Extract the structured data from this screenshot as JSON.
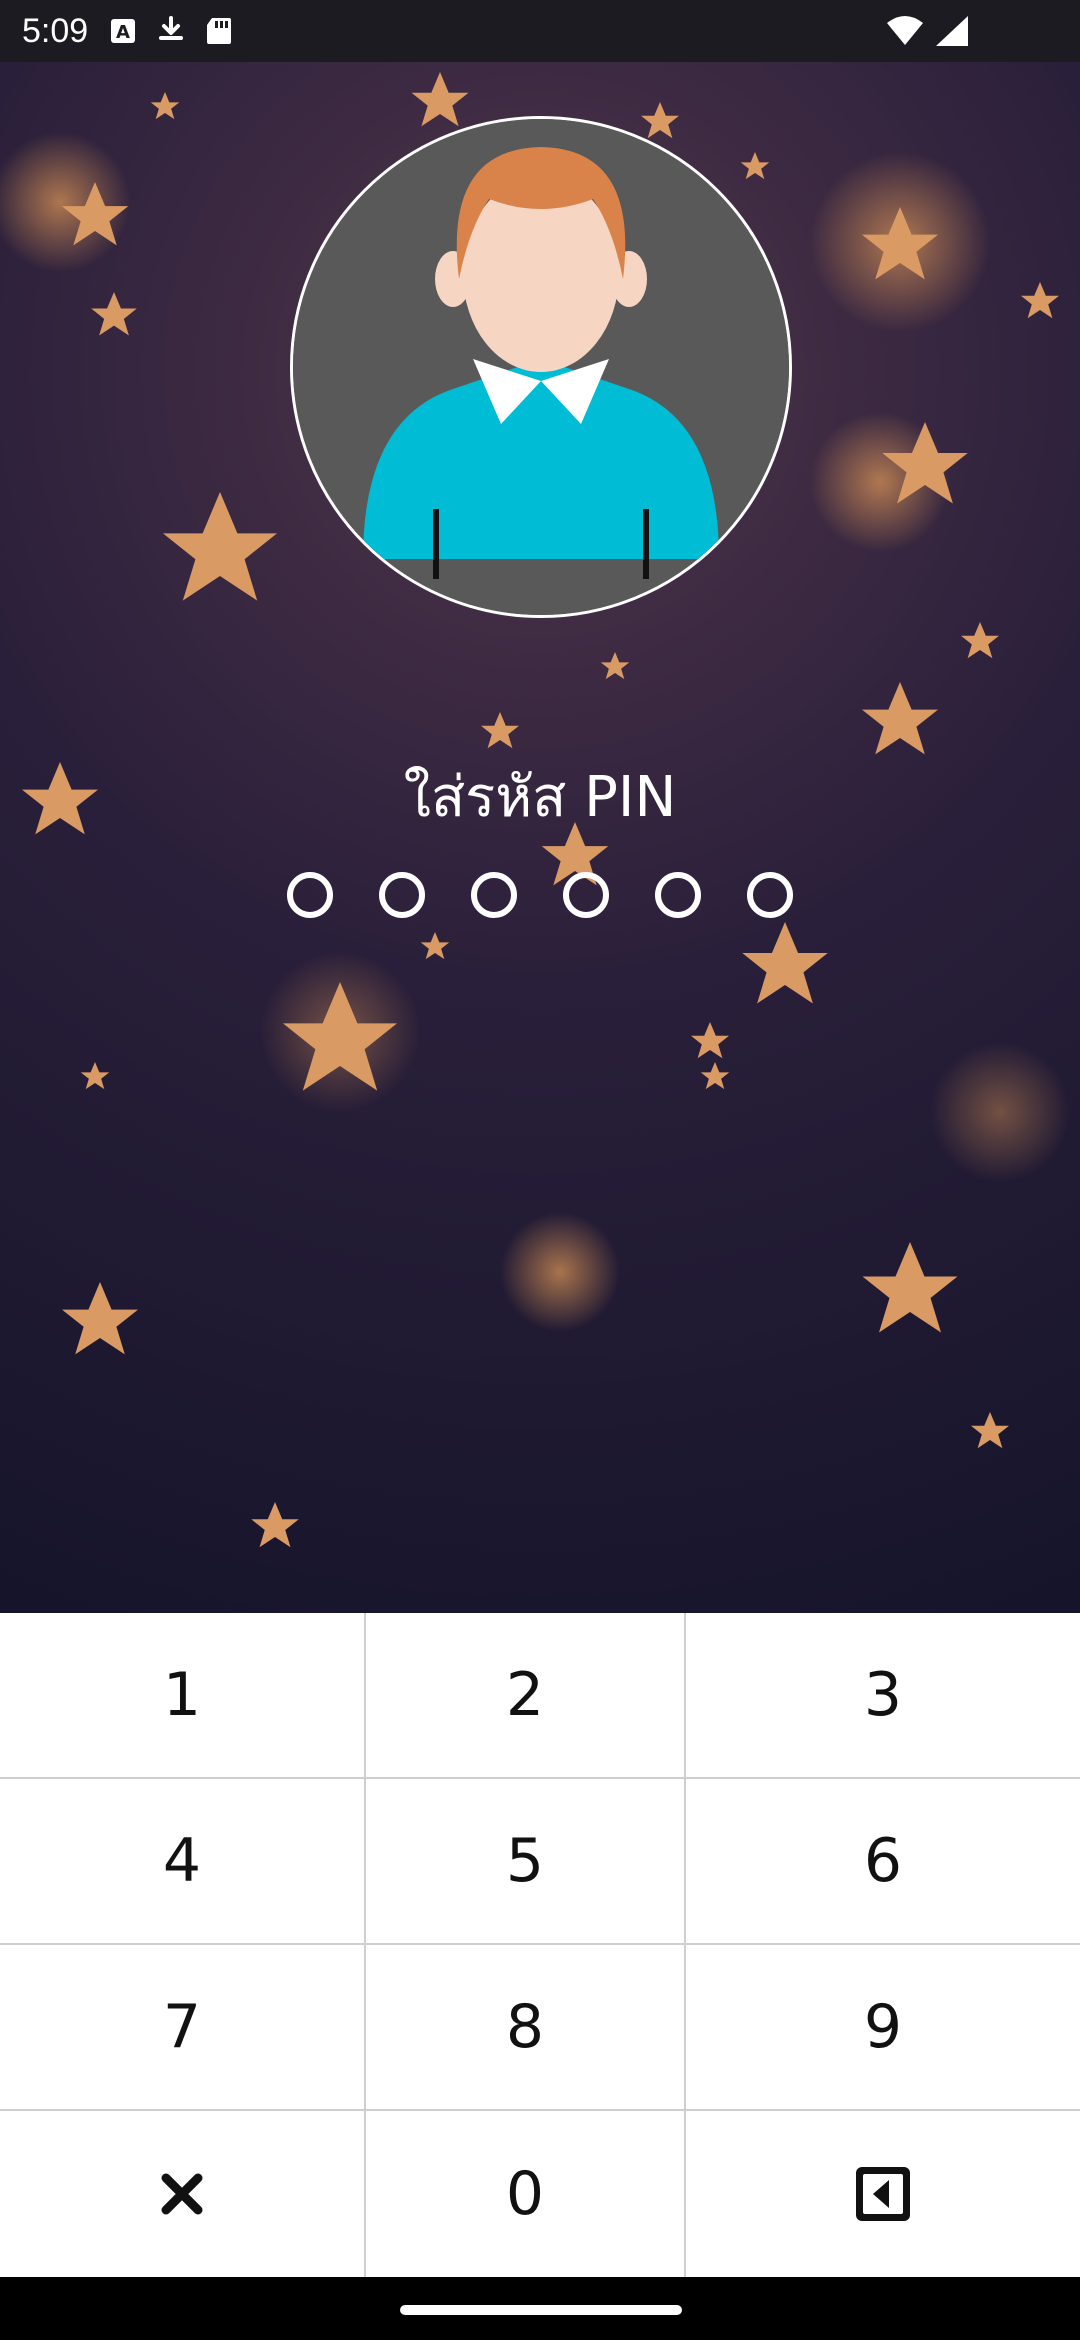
{
  "status_bar": {
    "time": "5:09",
    "icons_left": [
      "a-icon",
      "download-icon",
      "sd-card-icon"
    ],
    "icons_right": [
      "wifi-icon",
      "signal-icon"
    ]
  },
  "pin": {
    "title": "ใส่รหัส PIN",
    "dot_count": 6
  },
  "keypad": {
    "keys": [
      "1",
      "2",
      "3",
      "4",
      "5",
      "6",
      "7",
      "8",
      "9",
      "",
      "0",
      ""
    ],
    "clear_icon": "close-icon",
    "backspace_icon": "backspace-icon"
  },
  "colors": {
    "status_bar_bg": "#1c1b22",
    "keypad_bg": "#ffffff",
    "avatar_bg": "#595959",
    "shirt": "#00bcd4",
    "hair": "#d9834a",
    "skin": "#f6d6c3"
  }
}
